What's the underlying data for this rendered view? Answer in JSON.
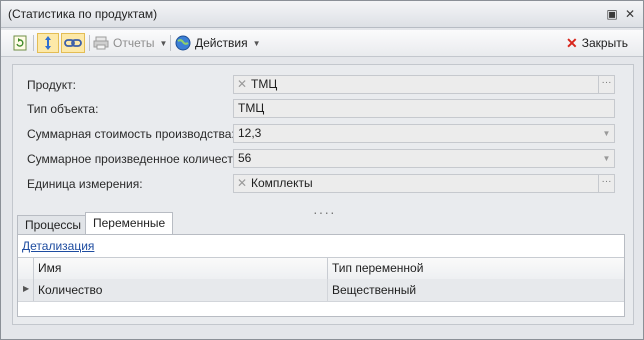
{
  "window": {
    "title": "(Статистика по продуктам)",
    "controls": [
      "restore-icon",
      "close-icon"
    ]
  },
  "toolbar": {
    "reports_label": "Отчеты",
    "actions_label": "Действия",
    "close_label": "Закрыть"
  },
  "form": {
    "product_label": "Продукт:",
    "product_value": "ТМЦ",
    "object_type_label": "Тип объекта:",
    "object_type_value": "ТМЦ",
    "total_cost_label": "Суммарная стоимость производства:",
    "total_cost_value": "12,3",
    "total_qty_label": "Суммарное произведенное количество:",
    "total_qty_value": "56",
    "unit_label": "Единица измерения:",
    "unit_value": "Комплекты"
  },
  "tabs": [
    {
      "label": "Процессы"
    },
    {
      "label": "Переменные"
    }
  ],
  "panel": {
    "detail_link": "Детализация",
    "columns": [
      "Имя",
      "Тип переменной"
    ],
    "rows": [
      {
        "name": "Количество",
        "type": "Вещественный"
      }
    ]
  },
  "colors": {
    "accent_link": "#1e4ca0",
    "toggle_bg": "#fde9a8",
    "close_x": "#d8261c"
  }
}
